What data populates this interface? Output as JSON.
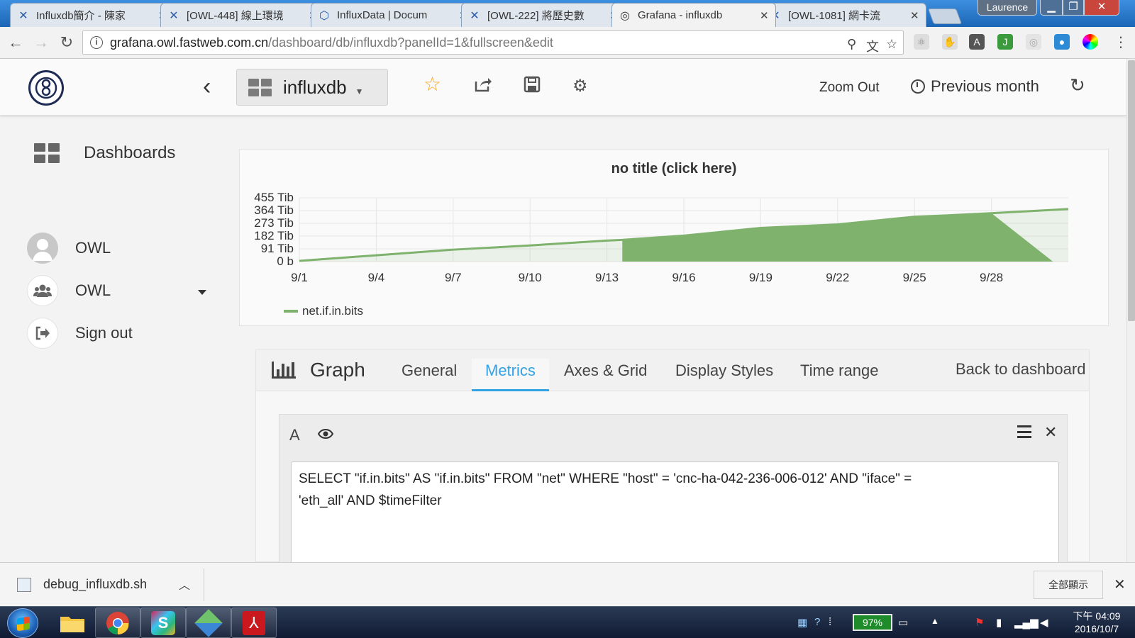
{
  "browser": {
    "tabs": [
      {
        "title": "Influxdb簡介 - 陳家",
        "icon": "jira-icon"
      },
      {
        "title": "[OWL-448] 線上環境",
        "icon": "jira-icon"
      },
      {
        "title": "InfluxData | Docum",
        "icon": "influx-icon"
      },
      {
        "title": "[OWL-222] 將歷史數",
        "icon": "jira-icon"
      },
      {
        "title": "Grafana - influxdb",
        "icon": "grafana-icon",
        "active": true
      },
      {
        "title": "[OWL-1081] 網卡流",
        "icon": "jira-icon"
      }
    ],
    "user": "Laurence",
    "url_host": "grafana.owl.fastweb.com.cn",
    "url_path": "/dashboard/db/influxdb?panelId=1&fullscreen&edit"
  },
  "grafana": {
    "dashboard_name": "influxdb",
    "zoom_out": "Zoom Out",
    "time_range": "Previous month",
    "side_menu": {
      "dashboards": "Dashboards",
      "user": "OWL",
      "org": "OWL",
      "sign_out": "Sign out"
    },
    "panel": {
      "title": "no title (click here)",
      "legend": "net.if.in.bits"
    },
    "editor": {
      "panel_type": "Graph",
      "tabs": [
        "General",
        "Metrics",
        "Axes & Grid",
        "Display Styles",
        "Time range"
      ],
      "active_tab": "Metrics",
      "back": "Back to dashboard",
      "query_ref": "A",
      "query": "SELECT \"if.in.bits\" AS \"if.in.bits\" FROM \"net\" WHERE \"host\" = 'cnc-ha-042-236-006-012' AND \"iface\" =\n'eth_all' AND $timeFilter"
    }
  },
  "chart_data": {
    "type": "area",
    "title": "no title (click here)",
    "xlabel": "",
    "ylabel": "",
    "x_ticks": [
      "9/1",
      "9/4",
      "9/7",
      "9/10",
      "9/13",
      "9/16",
      "9/19",
      "9/22",
      "9/25",
      "9/28"
    ],
    "y_ticks": [
      "0 b",
      "91 Tib",
      "182 Tib",
      "273 Tib",
      "364 Tib",
      "455 Tib"
    ],
    "ylim": [
      0,
      455
    ],
    "y_unit": "Tib",
    "xlim_days": [
      1,
      31
    ],
    "series": [
      {
        "name": "net.if.in.bits",
        "color": "#7eb26d",
        "points": [
          [
            1,
            5
          ],
          [
            4,
            45
          ],
          [
            7,
            85
          ],
          [
            10,
            115
          ],
          [
            13,
            150
          ],
          [
            13.6,
            155
          ],
          [
            16,
            185
          ],
          [
            19,
            240
          ],
          [
            22,
            265
          ],
          [
            25,
            320
          ],
          [
            26.3,
            330
          ],
          [
            28,
            345
          ],
          [
            31,
            375
          ]
        ],
        "gaps_to_zero": [
          [
            13.6,
            30.4
          ]
        ]
      }
    ],
    "grid": true,
    "legend_position": "bottom-left"
  },
  "download": {
    "file": "debug_influxdb.sh",
    "show_all": "全部顯示"
  },
  "taskbar": {
    "battery": "97%",
    "time": "下午 04:09",
    "date": "2016/10/7"
  }
}
